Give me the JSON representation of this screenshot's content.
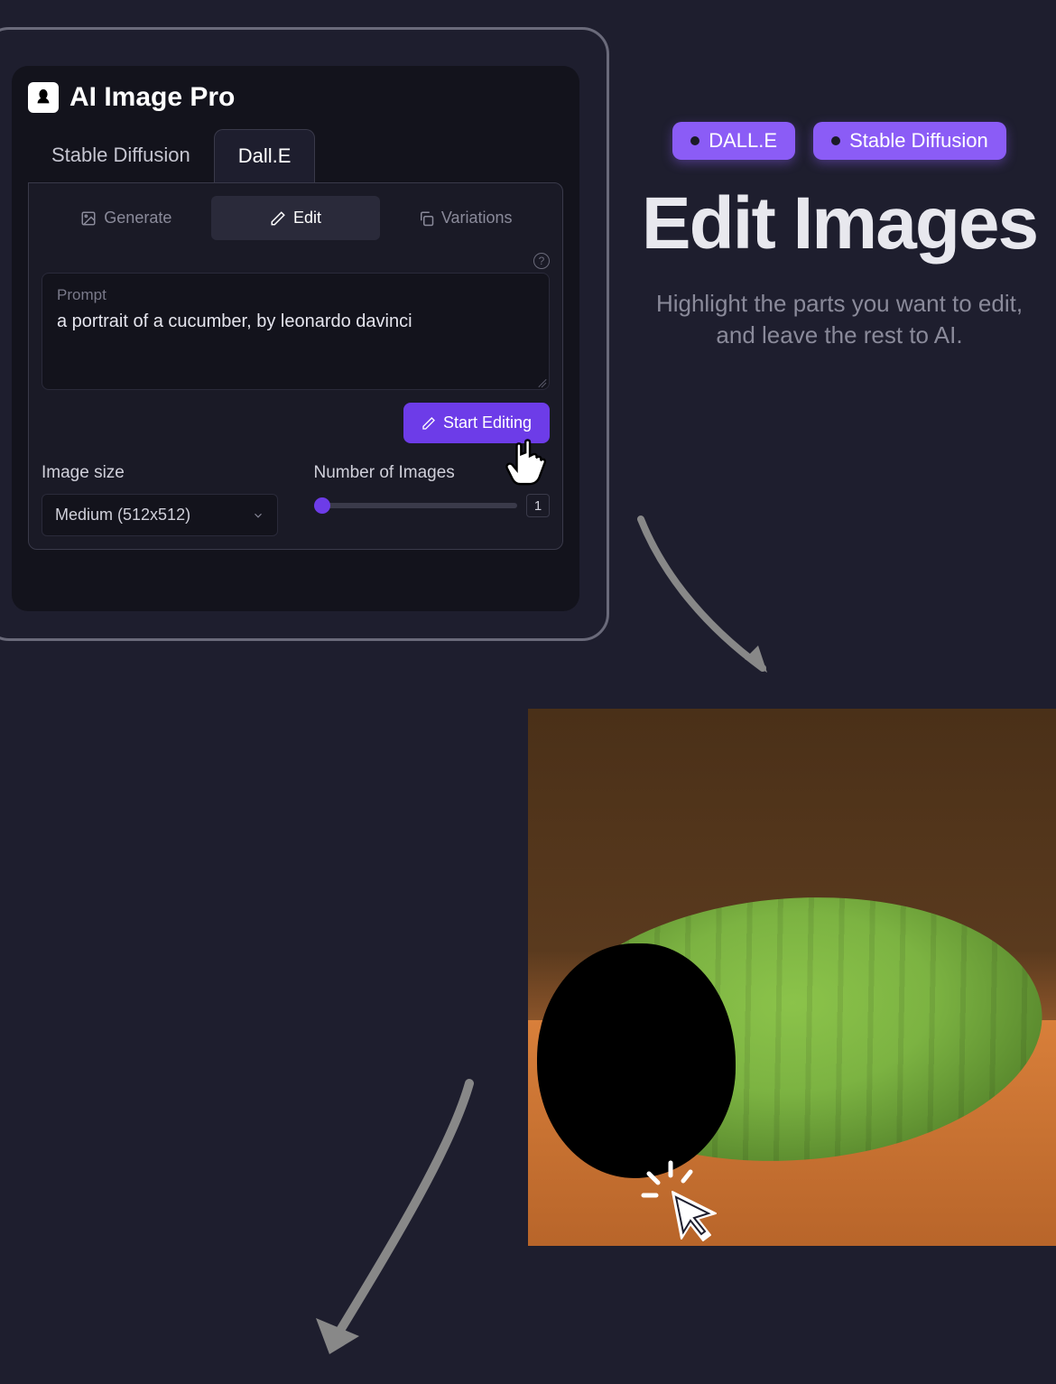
{
  "app": {
    "title": "AI Image Pro"
  },
  "modelTabs": [
    {
      "label": "Stable Diffusion",
      "active": false
    },
    {
      "label": "Dall.E",
      "active": true
    }
  ],
  "actionTabs": [
    {
      "label": "Generate",
      "active": false
    },
    {
      "label": "Edit",
      "active": true
    },
    {
      "label": "Variations",
      "active": false
    }
  ],
  "prompt": {
    "label": "Prompt",
    "value": "a portrait of a cucumber, by leonardo davinci"
  },
  "startButton": "Start Editing",
  "imageSize": {
    "label": "Image size",
    "value": "Medium (512x512)"
  },
  "numImages": {
    "label": "Number of Images",
    "value": "1"
  },
  "hero": {
    "badges": [
      "DALL.E",
      "Stable Diffusion"
    ],
    "title": "Edit Images",
    "subtitle": "Highlight the parts you want to edit, and leave the rest to AI."
  }
}
